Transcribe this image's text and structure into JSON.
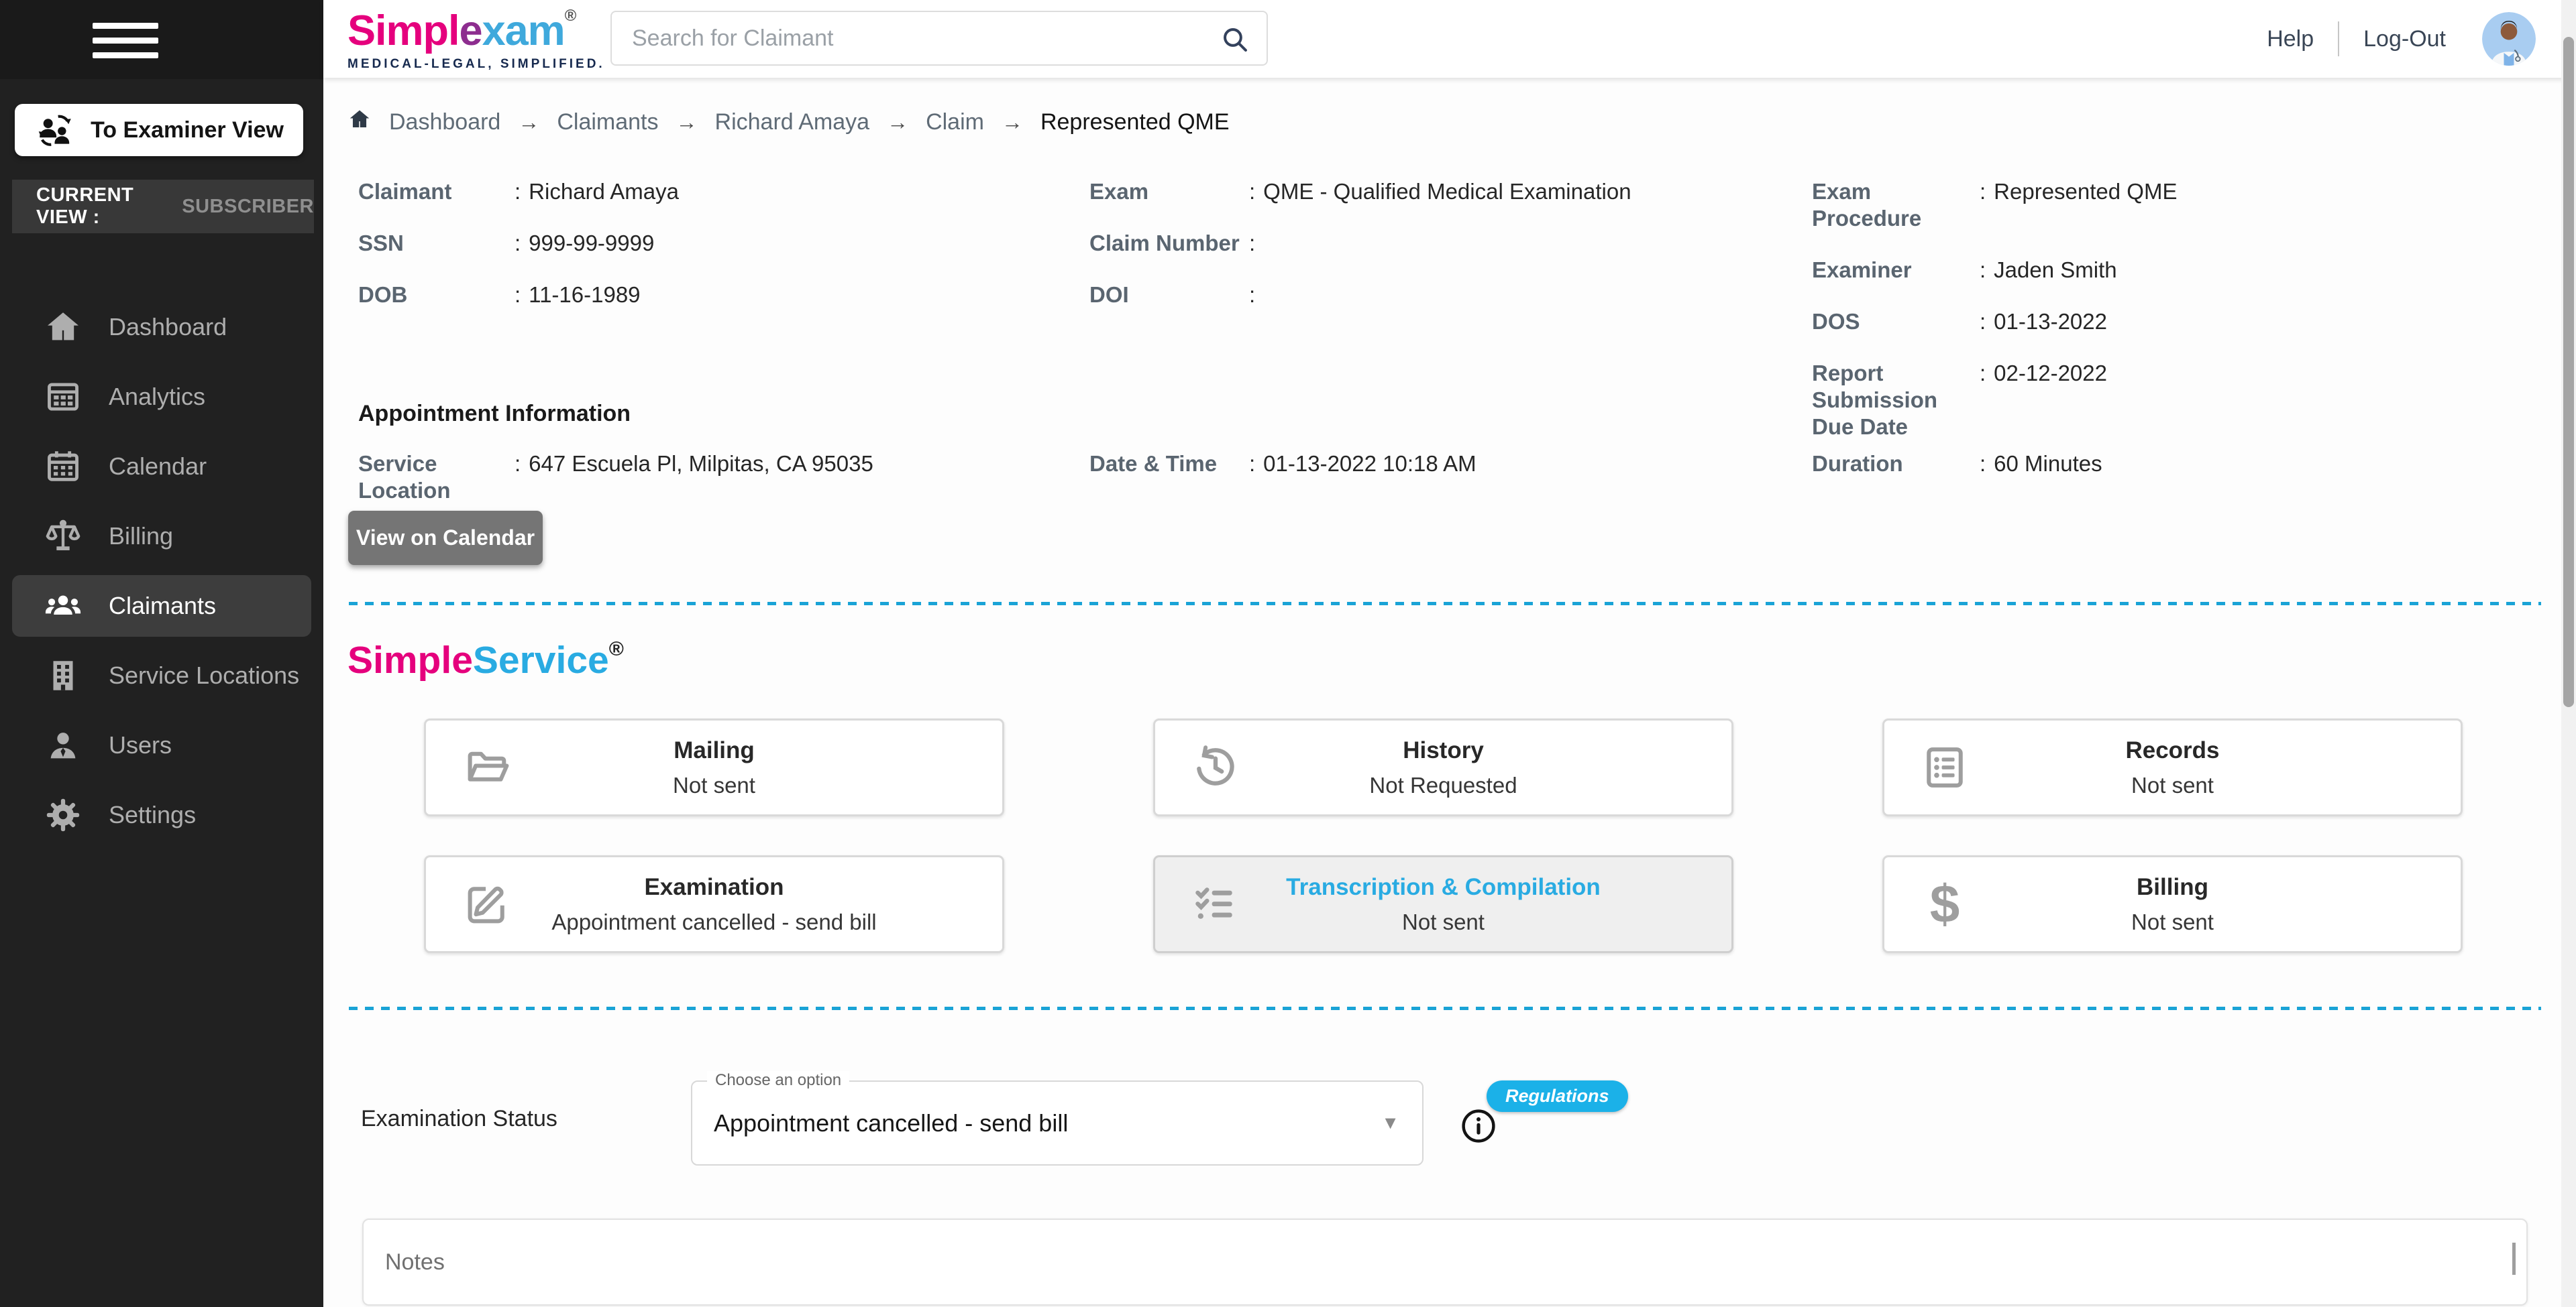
{
  "glyphs": {
    "colon": ":",
    "breadcrumb_arrow": "→",
    "caret": "▼",
    "dollar": "$",
    "registered": "®"
  },
  "colors": {
    "brand_pink": "#e5007d",
    "brand_blue": "#29abe2",
    "dash_cyan": "#1aa3d6",
    "badge_cyan": "#1bb1e8",
    "sidebar_bg": "#212121"
  },
  "sidebar": {
    "to_examiner_view": "To Examiner View",
    "current_view_label": "CURRENT VIEW :",
    "current_view_value": "SUBSCRIBER",
    "items": [
      {
        "label": "Dashboard"
      },
      {
        "label": "Analytics"
      },
      {
        "label": "Calendar"
      },
      {
        "label": "Billing"
      },
      {
        "label": "Claimants"
      },
      {
        "label": "Service Locations"
      },
      {
        "label": "Users"
      },
      {
        "label": "Settings"
      }
    ]
  },
  "header": {
    "logo_part1": "Simpl",
    "logo_part2": "e",
    "logo_part3": "xam",
    "tagline": "MEDICAL-LEGAL, SIMPLIFIED.",
    "search_placeholder": "Search for Claimant",
    "help": "Help",
    "logout": "Log-Out"
  },
  "breadcrumb": {
    "items": [
      "Dashboard",
      "Claimants",
      "Richard Amaya",
      "Claim"
    ],
    "current": "Represented QME"
  },
  "claim_info": {
    "col1": [
      {
        "label": "Claimant",
        "value": "Richard Amaya"
      },
      {
        "label": "SSN",
        "value": "999-99-9999"
      },
      {
        "label": "DOB",
        "value": "11-16-1989"
      }
    ],
    "col2": [
      {
        "label": "Exam",
        "value": "QME - Qualified Medical Examination"
      },
      {
        "label": "Claim Number",
        "value": ""
      },
      {
        "label": "DOI",
        "value": ""
      }
    ],
    "col3": [
      {
        "label": "Exam Procedure",
        "value": "Represented QME"
      },
      {
        "label": "Examiner",
        "value": "Jaden Smith"
      },
      {
        "label": "DOS",
        "value": "01-13-2022"
      },
      {
        "label": "Report Submission Due Date",
        "value": "02-12-2022"
      }
    ]
  },
  "appointment": {
    "title": "Appointment Information",
    "service_location_label": "Service Location",
    "service_location": "647 Escuela Pl, Milpitas, CA 95035",
    "datetime_label": "Date & Time",
    "datetime": "01-13-2022 10:18 AM",
    "duration_label": "Duration",
    "duration": "60 Minutes",
    "view_on_calendar": "View on Calendar"
  },
  "simpleservice": {
    "title_part1": "Simple",
    "title_part2": "Service",
    "cards": [
      {
        "title": "Mailing",
        "status": "Not sent"
      },
      {
        "title": "History",
        "status": "Not Requested"
      },
      {
        "title": "Records",
        "status": "Not sent"
      },
      {
        "title": "Examination",
        "status": "Appointment cancelled - send bill"
      },
      {
        "title": "Transcription & Compilation",
        "status": "Not sent"
      },
      {
        "title": "Billing",
        "status": "Not sent"
      }
    ]
  },
  "examination_status": {
    "label": "Examination Status",
    "dropdown_label": "Choose an option",
    "dropdown_value": "Appointment cancelled - send bill",
    "badge": "Regulations"
  },
  "notes_placeholder": "Notes"
}
